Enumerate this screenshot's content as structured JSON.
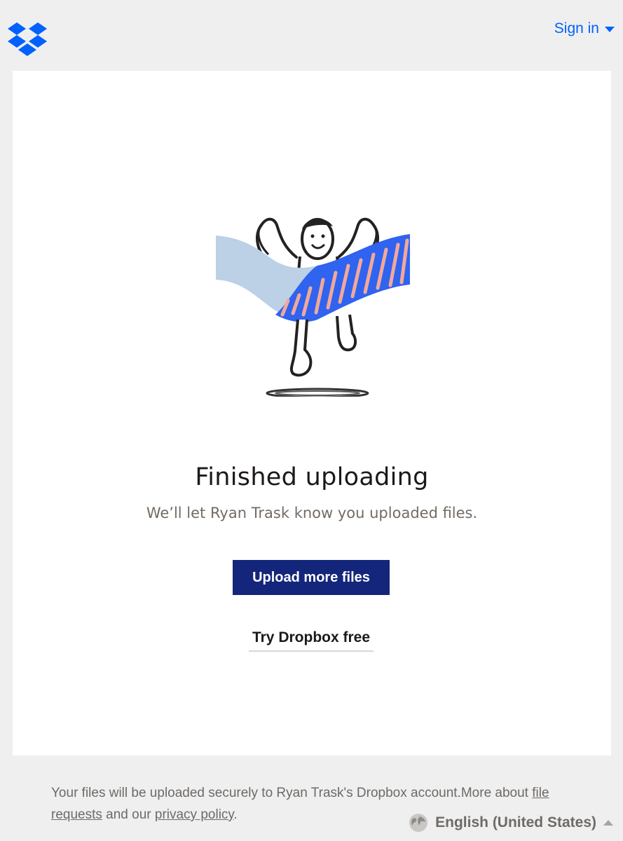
{
  "header": {
    "logo_icon": "dropbox-logo-icon",
    "signin_label": "Sign in",
    "signin_icon": "chevron-down-icon"
  },
  "main": {
    "illustration": "person-celebrating-banner",
    "title": "Finished uploading",
    "subtitle": "We’ll let Ryan Trask know you uploaded files.",
    "primary_button": "Upload more files",
    "secondary_link": "Try Dropbox free"
  },
  "footer": {
    "text_before": "Your files will be uploaded securely to Ryan Trask's Dropbox account.More about ",
    "file_requests_link": "file requests",
    "text_middle": " and our ",
    "privacy_link": "privacy policy",
    "text_end": ".",
    "language_label": "English (United States)",
    "language_icon": "globe-icon",
    "language_caret": "chevron-up-icon"
  },
  "colors": {
    "brand_blue": "#0061fe",
    "button_navy": "#14267b",
    "background": "#efefef"
  }
}
